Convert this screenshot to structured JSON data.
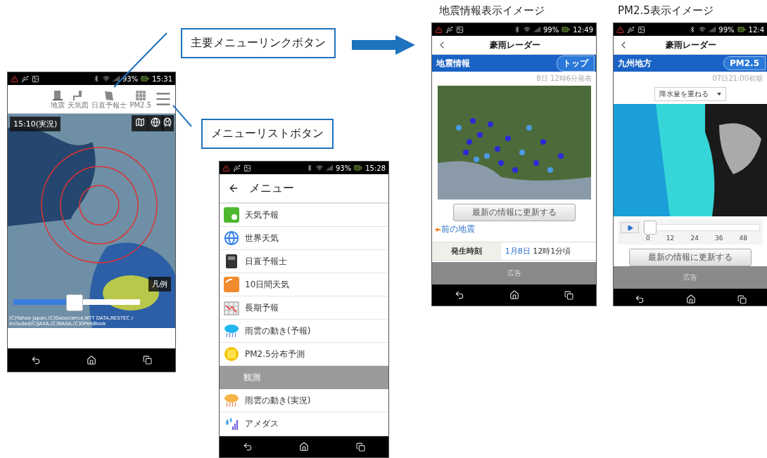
{
  "callouts": [
    {
      "text": "主要メニューリンクボタン"
    },
    {
      "text": "メニューリストボタン"
    }
  ],
  "main_screen": {
    "status": {
      "battery": "93%",
      "time": "15:31"
    },
    "toolbar_links": [
      {
        "label": "地震"
      },
      {
        "label": "天気図"
      },
      {
        "label": "日直予報士"
      },
      {
        "label": "PM2.5"
      }
    ],
    "time_label": "15:10(実況)",
    "legend_button": "凡例",
    "slider": {
      "level": 0.48
    },
    "copyright": "(C)Yahoo Japan,(C)Geoscience,NTT DATA,RESTEC / Included(C)JAXA,(C)NASA,(C)OPeNBook"
  },
  "menu_screen": {
    "status": {
      "battery": "93%",
      "time": "15:28"
    },
    "title": "メニュー",
    "items": [
      {
        "kind": "item",
        "label": "天気予報"
      },
      {
        "kind": "item",
        "label": "世界天気"
      },
      {
        "kind": "item",
        "label": "日直予報士"
      },
      {
        "kind": "item",
        "label": "10日間天気"
      },
      {
        "kind": "item",
        "label": "長期予報"
      },
      {
        "kind": "item",
        "label": "雨雲の動き(予報)"
      },
      {
        "kind": "item",
        "label": "PM2.5分布予測"
      },
      {
        "kind": "section",
        "label": "観測"
      },
      {
        "kind": "item",
        "label": "雨雲の動き(実況)"
      },
      {
        "kind": "item",
        "label": "アメダス"
      }
    ]
  },
  "quake_screen": {
    "caption": "地震情報表示イメージ",
    "status": {
      "battery": "99%",
      "time": "12:49"
    },
    "app_title": "豪雨レーダー",
    "section_title": "地震情報",
    "tab_button": "トップ",
    "published": "8日 12時6分発表",
    "refresh_button": "最新の情報に更新する",
    "prev_link": "前の地震",
    "table": [
      {
        "label": "発生時刻",
        "date": "1月8日",
        "time": "12時1分頃"
      }
    ],
    "ad": "広告"
  },
  "pm25_screen": {
    "caption": "PM2.5表示イメージ",
    "status": {
      "battery": "99%",
      "time": "12:4"
    },
    "app_title": "豪雨レーダー",
    "section_title": "九州地方",
    "tab_button": "PM2.5",
    "init_time": "07日21:00初期",
    "dropdown": "降水量を重ねる",
    "slider": {
      "level": 0
    },
    "ticks": [
      "0",
      "12",
      "24",
      "36",
      "48"
    ],
    "refresh_button": "最新の情報に更新する",
    "ad": "広告"
  }
}
